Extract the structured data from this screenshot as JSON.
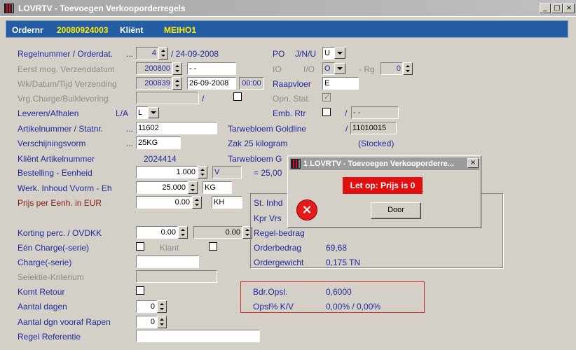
{
  "window": {
    "title": "LOVRTV - Toevoegen Verkooporderregels",
    "min": "_",
    "max": "□",
    "close": "×"
  },
  "order": {
    "ordernr_label": "Ordernr",
    "ordernr": "20080924003",
    "klient_label": "Kliënt",
    "klient": "MEIHO1"
  },
  "form": {
    "regelnummer": {
      "label": "Regelnummer / Orderdat.",
      "dots": "...",
      "value": "4",
      "date": "/ 24-09-2008"
    },
    "eerst": {
      "label": "Eerst mog. Verzenddatum",
      "value": "200800",
      "date": " - -"
    },
    "wk": {
      "label": "Wk/Datum/Tijd Verzending",
      "value": "200839",
      "date": "26-09-2008",
      "time": "00:00"
    },
    "vrg": {
      "label": "Vrg.Charge/Bulklevering",
      "slash": "/"
    },
    "leveren": {
      "label": "Leveren/Afhalen",
      "sub": "L/A",
      "value": "L"
    },
    "artikel": {
      "label": "Artikelnummer / Statnr.",
      "dots": "...",
      "value": "11602",
      "desc": "Tarwebloem Goldline",
      "slash": "/",
      "statnr": "11010015"
    },
    "verschijning": {
      "label": "Verschijningsvorm",
      "dots": "...",
      "value": "25KG",
      "desc": "Zak 25 kilogram",
      "stock": "(Stocked)"
    },
    "klientart": {
      "label": "Kliënt Artikelnummer",
      "value": "2024414",
      "desc": "Tarwebloem G"
    },
    "bestelling": {
      "label": "Bestelling - Eenheid",
      "value": "1.000",
      "unit": "V",
      "eq": "= 25,00"
    },
    "werk": {
      "label": "Werk. Inhoud Vvorm - Eh",
      "value": "25.000",
      "unit": "KG"
    },
    "prijs": {
      "label": "Prijs per Eenh. in EUR",
      "value": "0.00",
      "unit": "KH"
    },
    "korting": {
      "label": "Korting perc. / OVDKK",
      "value1": "0.00",
      "value2": "0.00"
    },
    "een": {
      "label": "Eén Charge(-serie)",
      "klant": "Klant"
    },
    "charge": {
      "label": "Charge(-serie)"
    },
    "selektie": {
      "label": "Selektie-Kriterium"
    },
    "komt": {
      "label": "Komt Retour"
    },
    "aantal": {
      "label": "Aantal dagen",
      "value": "0"
    },
    "aantaldgn": {
      "label": "Aantal dgn vooraf Rapen",
      "value": "0"
    },
    "regelref": {
      "label": "Regel Referentie"
    }
  },
  "right": {
    "po": {
      "label": "PO",
      "sub": "J/N/U",
      "value": "U"
    },
    "io": {
      "label": "IO",
      "sub": "I/O",
      "value": "O",
      "rg_label": "- Rg",
      "rg": "0"
    },
    "raapvloer": {
      "label": "Raapvloer",
      "value": "E"
    },
    "opn": {
      "label": "Opn. Stat."
    },
    "emb": {
      "label": "Emb. Rtr",
      "slash": "/",
      "value": "- -"
    }
  },
  "summary": {
    "st": "St. Inhd",
    "kpr": "Kpr Vrs",
    "regel": "Regel-bedrag",
    "orderbedrag_label": "Orderbedrag",
    "orderbedrag": "69,68",
    "ordergewicht_label": "Ordergewicht",
    "ordergewicht": "0,175 TN"
  },
  "opsl": {
    "bdr_label": "Bdr.Opsl.",
    "bdr": "0,6000",
    "pct_label": "Opsl% K/V",
    "pct": "0,00% / 0,00%"
  },
  "dialog": {
    "title": "1 LOVRTV - Toevoegen Verkooporderre...",
    "message": "Let op: Prijs is 0",
    "button": "Door",
    "close": "×"
  },
  "colors": {
    "label": "#1f2a9e",
    "orderbar": "#245da3",
    "warning": "#e01010"
  }
}
